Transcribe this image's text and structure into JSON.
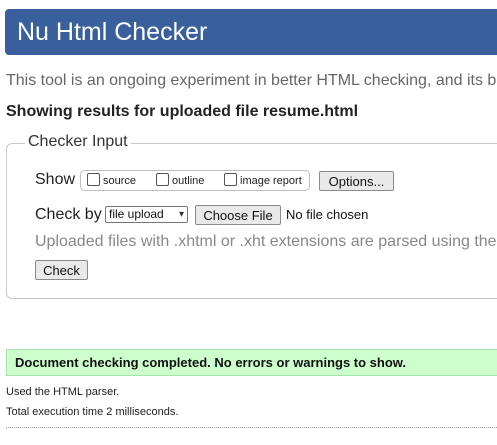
{
  "header": {
    "title": "Nu Html Checker"
  },
  "intro": "This tool is an ongoing experiment in better HTML checking, and its be",
  "results_heading": "Showing results for uploaded file resume.html",
  "checker_input": {
    "legend": "Checker Input",
    "show_label": "Show",
    "show_options": [
      {
        "label": "source",
        "checked": false
      },
      {
        "label": "outline",
        "checked": false
      },
      {
        "label": "image report",
        "checked": false
      }
    ],
    "options_button": "Options...",
    "check_by_label": "Check by",
    "check_by_selected": "file upload",
    "choose_file_button": "Choose File",
    "no_file_text": "No file chosen",
    "upload_note": "Uploaded files with .xhtml or .xht extensions are parsed using the",
    "check_button": "Check"
  },
  "success_message": "Document checking completed. No errors or warnings to show.",
  "parser_info": "Used the HTML parser.",
  "execution_time": "Total execution time 2 milliseconds."
}
